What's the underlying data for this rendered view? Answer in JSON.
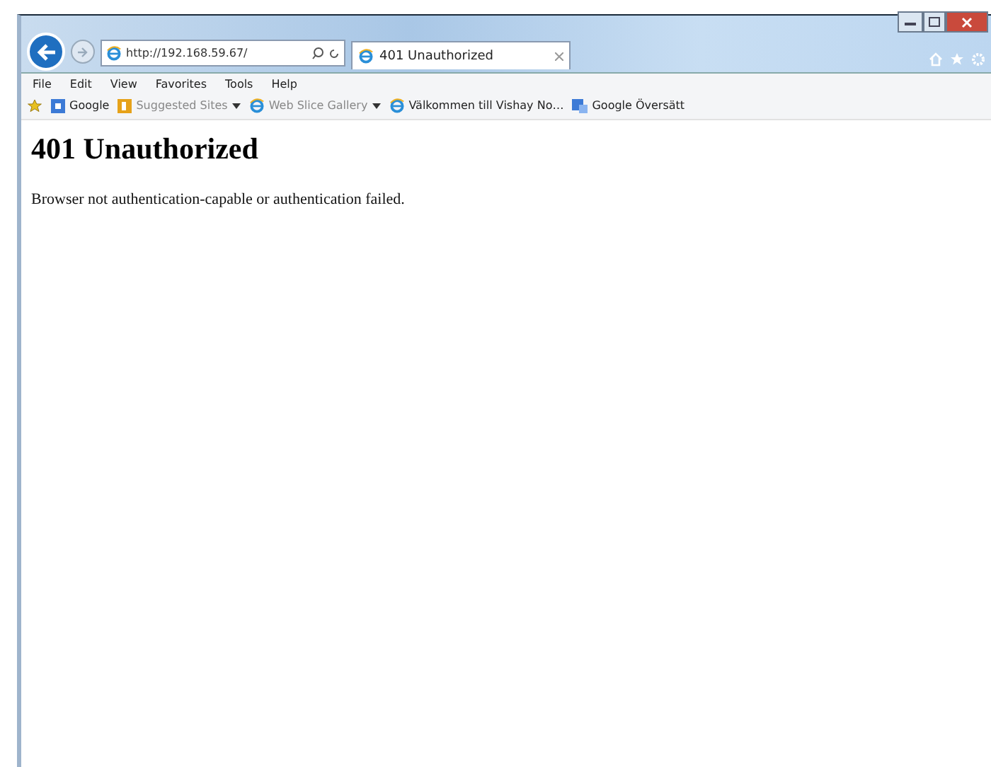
{
  "address_bar": {
    "value": "http://192.168.59.67/"
  },
  "tabs": [
    {
      "label": "401 Unauthorized",
      "selected": true
    }
  ],
  "menu_bar": [
    "File",
    "Edit",
    "View",
    "Favorites",
    "Tools",
    "Help"
  ],
  "favorites_bar": [
    {
      "label": "Google",
      "kind": "google",
      "dropdown": false,
      "disabled": false
    },
    {
      "label": "Suggested Sites",
      "kind": "suggested",
      "dropdown": true,
      "disabled": true
    },
    {
      "label": "Web Slice Gallery",
      "kind": "page",
      "dropdown": true,
      "disabled": true
    },
    {
      "label": "Välkommen till Vishay No…",
      "kind": "page",
      "dropdown": false,
      "disabled": false
    },
    {
      "label": "Google Översätt",
      "kind": "translate",
      "dropdown": false,
      "disabled": false
    }
  ],
  "page": {
    "heading": "401 Unauthorized",
    "message": "Browser not authentication-capable or authentication failed."
  }
}
